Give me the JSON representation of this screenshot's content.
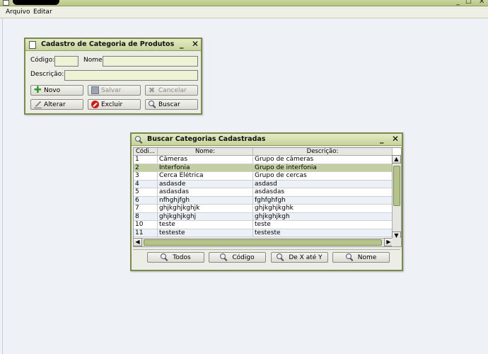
{
  "menu": {
    "arquivo": "Arquivo",
    "editar": "Editar"
  },
  "window_controls": {
    "minimize": "_",
    "maximize": "☐",
    "close": "✕"
  },
  "cadastro": {
    "title": "Cadastro de Categoria de Produtos",
    "codigo_label": "Código:",
    "nome_label": "Nome:",
    "descricao_label": "Descrição:",
    "codigo_value": "",
    "nome_value": "",
    "descricao_value": "",
    "buttons": {
      "novo": "Novo",
      "salvar": "Salvar",
      "cancelar": "Cancelar",
      "alterar": "Alterar",
      "excluir": "Excluir",
      "buscar": "Buscar"
    }
  },
  "busca": {
    "title": "Buscar Categorias Cadastradas",
    "columns": [
      "Códi...",
      "Nome:",
      "Descrição:"
    ],
    "rows": [
      {
        "id": "1",
        "nome": "Câmeras",
        "descricao": "Grupo de câmeras"
      },
      {
        "id": "2",
        "nome": "Interfonia",
        "descricao": "Grupo de interfonia"
      },
      {
        "id": "3",
        "nome": "Cerca Elétrica",
        "descricao": "Grupo de cercas"
      },
      {
        "id": "4",
        "nome": "asdasde",
        "descricao": "asdasd"
      },
      {
        "id": "5",
        "nome": "asdasdas",
        "descricao": "asdasdas"
      },
      {
        "id": "6",
        "nome": "nfhghjfgh",
        "descricao": "fghfghfgh"
      },
      {
        "id": "7",
        "nome": "ghjkghjkghjk",
        "descricao": "ghjkghjkghk"
      },
      {
        "id": "8",
        "nome": "ghjkghjkghj",
        "descricao": "ghjkghjkgh"
      },
      {
        "id": "10",
        "nome": "teste",
        "descricao": "teste"
      },
      {
        "id": "11",
        "nome": "testeste",
        "descricao": "testeste"
      }
    ],
    "selected_row": "2",
    "buttons": {
      "todos": "Todos",
      "codigo": "Código",
      "de_x_ate_y": "De X até Y",
      "nome": "Nome"
    }
  }
}
